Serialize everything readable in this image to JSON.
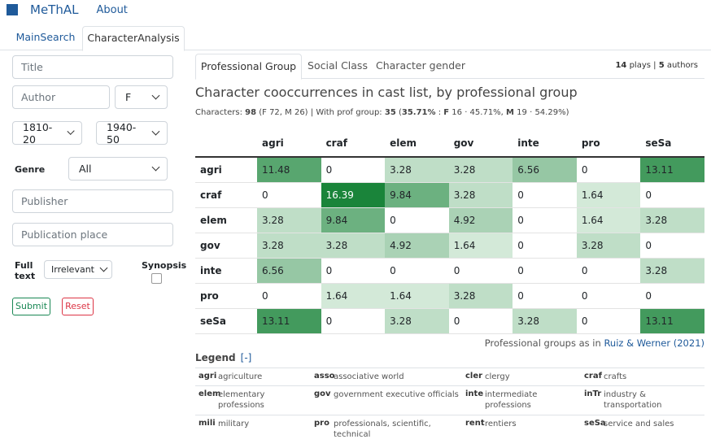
{
  "app": {
    "brand": "MeThAL",
    "about": "About"
  },
  "main_tabs": [
    "MainSearch",
    "CharacterAnalysis"
  ],
  "filters": {
    "title_placeholder": "Title",
    "author_placeholder": "Author",
    "gender_value": "F",
    "period_from": "1810-20",
    "period_to": "1940-50",
    "genre_label": "Genre",
    "genre_value": "All",
    "publisher_placeholder": "Publisher",
    "place_placeholder": "Publication place",
    "fulltext_label_1": "Full",
    "fulltext_label_2": "text",
    "fulltext_value": "Irrelevant",
    "synopsis_label": "Synopsis",
    "submit": "Submit",
    "reset": "Reset"
  },
  "sub_tabs": [
    "Professional Group",
    "Social Class",
    "Character gender"
  ],
  "counts": {
    "plays_n": "14",
    "plays_word": " plays",
    "sep": " | ",
    "authors_n": "5",
    "authors_word": " authors"
  },
  "heading": "Character cooccurrences in cast list, by professional group",
  "stats": {
    "p1": "Characters: ",
    "chars": "98",
    "p2": " (F 72, M 26) | With prof group: ",
    "withprof": "35",
    "p3": " (",
    "pct": "35.71%",
    "p4": " : ",
    "fl": "F",
    "p5": " 16 · 45.71%, ",
    "ml": "M",
    "p6": " 19 · 54.29%)"
  },
  "matrix": {
    "columns": [
      "agri",
      "craf",
      "elem",
      "gov",
      "inte",
      "pro",
      "seSa"
    ],
    "rows": [
      {
        "label": "agri",
        "values": [
          "11.48",
          "0",
          "3.28",
          "3.28",
          "6.56",
          "0",
          "13.11"
        ]
      },
      {
        "label": "craf",
        "values": [
          "0",
          "16.39",
          "9.84",
          "3.28",
          "0",
          "1.64",
          "0"
        ]
      },
      {
        "label": "elem",
        "values": [
          "3.28",
          "9.84",
          "0",
          "4.92",
          "0",
          "1.64",
          "3.28"
        ]
      },
      {
        "label": "gov",
        "values": [
          "3.28",
          "3.28",
          "4.92",
          "1.64",
          "0",
          "3.28",
          "0"
        ]
      },
      {
        "label": "inte",
        "values": [
          "6.56",
          "0",
          "0",
          "0",
          "0",
          "0",
          "3.28"
        ]
      },
      {
        "label": "pro",
        "values": [
          "0",
          "1.64",
          "1.64",
          "3.28",
          "0",
          "0",
          "0"
        ]
      },
      {
        "label": "seSa",
        "values": [
          "13.11",
          "0",
          "3.28",
          "0",
          "3.28",
          "0",
          "13.11"
        ]
      }
    ]
  },
  "source": {
    "prefix": "Professional groups as in ",
    "link": "Ruiz & Werner (2021)"
  },
  "legend": {
    "title": "Legend",
    "toggle": "[-]",
    "rows": [
      [
        {
          "code": "agri",
          "text": "agriculture"
        },
        {
          "code": "asso",
          "text": "associative world"
        },
        {
          "code": "cler",
          "text": "clergy"
        },
        {
          "code": "craf",
          "text": "crafts"
        }
      ],
      [
        {
          "code": "elem",
          "text": "elementary professions"
        },
        {
          "code": "gov",
          "text": "government executive officials"
        },
        {
          "code": "inte",
          "text": "intermediate professions"
        },
        {
          "code": "inTr",
          "text": "industry & transportation"
        }
      ],
      [
        {
          "code": "mili",
          "text": "military"
        },
        {
          "code": "pro",
          "text": "professionals, scientific, technical"
        },
        {
          "code": "rent",
          "text": "rentiers"
        },
        {
          "code": "seSa",
          "text": "service and sales"
        }
      ]
    ]
  }
}
